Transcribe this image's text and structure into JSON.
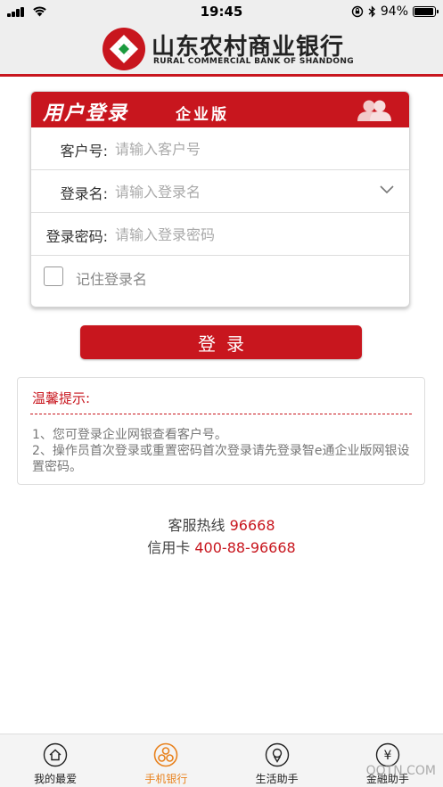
{
  "status_bar": {
    "time": "19:45",
    "battery_text": "94%",
    "battery_level": 0.94
  },
  "header": {
    "bank_name_cn": "山东农村商业银行",
    "bank_name_en": "RURAL COMMERCIAL BANK OF SHANDONG",
    "logo_icon": "bank-logo-icon",
    "brand_color": "#c8161e"
  },
  "login_card": {
    "title": "用户登录",
    "subtitle": "企业版",
    "header_icon": "users-icon",
    "fields": {
      "customer_no": {
        "label": "客户号:",
        "value": "",
        "placeholder": "请输入客户号"
      },
      "login_name": {
        "label": "登录名:",
        "value": "",
        "placeholder": "请输入登录名"
      },
      "password": {
        "label": "登录密码:",
        "value": "",
        "placeholder": "请输入登录密码"
      }
    },
    "remember_label": "记住登录名",
    "remember_checked": false
  },
  "login_button": {
    "label": "登录"
  },
  "tips": {
    "title": "温馨提示:",
    "line1": "1、您可登录企业网银查看客户号。",
    "line2": "2、操作员首次登录或重置密码首次登录请先登录智e通企业版网银设置密码。"
  },
  "hotline": {
    "service_label": "客服热线",
    "service_number": "96668",
    "card_label": "信用卡",
    "card_number": "400-88-96668"
  },
  "tabbar": {
    "tabs": [
      {
        "label": "我的最爱",
        "icon": "home-icon",
        "active": false
      },
      {
        "label": "手机银行",
        "icon": "mobile-bank-icon",
        "active": true
      },
      {
        "label": "生活助手",
        "icon": "life-assistant-icon",
        "active": false
      },
      {
        "label": "金融助手",
        "icon": "finance-assistant-icon",
        "active": false
      }
    ],
    "active_color": "#e8821e"
  },
  "watermark": "QQTN.COM"
}
